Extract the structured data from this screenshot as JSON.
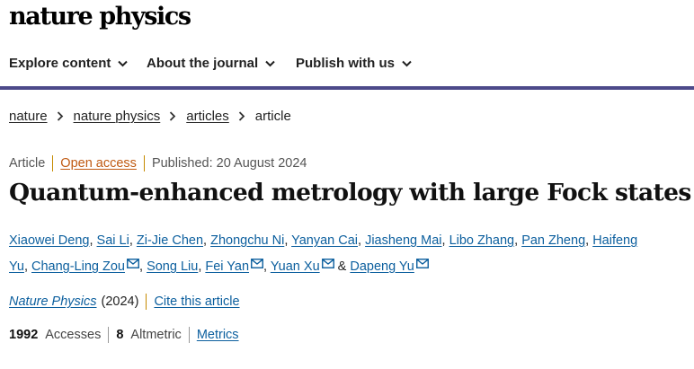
{
  "site": {
    "logo_text": "nature physics"
  },
  "nav": {
    "items": [
      {
        "label": "Explore content"
      },
      {
        "label": "About the journal"
      },
      {
        "label": "Publish with us"
      }
    ],
    "rule_color": "#4d4a8a"
  },
  "breadcrumb": {
    "items": [
      "nature",
      "nature physics",
      "articles"
    ],
    "current": "article"
  },
  "meta": {
    "type": "Article",
    "open_access": "Open access",
    "published": "Published: 20 August 2024"
  },
  "article": {
    "title": "Quantum-enhanced metrology with large Fock states"
  },
  "authors": {
    "list": [
      {
        "name": "Xiaowei Deng",
        "suffix": ", ",
        "email": false
      },
      {
        "name": "Sai Li",
        "suffix": ", ",
        "email": false
      },
      {
        "name": "Zi-Jie Chen",
        "suffix": ", ",
        "email": false
      },
      {
        "name": "Zhongchu Ni",
        "suffix": ", ",
        "email": false
      },
      {
        "name": "Yanyan Cai",
        "suffix": ", ",
        "email": false
      },
      {
        "name": "Jiasheng Mai",
        "suffix": ", ",
        "email": false
      },
      {
        "name": "Libo Zhang",
        "suffix": ", ",
        "email": false
      },
      {
        "name": "Pan Zheng",
        "suffix": ", ",
        "email": false
      },
      {
        "name": "Haifeng Yu",
        "suffix": ", ",
        "email": false
      },
      {
        "name": "Chang-Ling Zou",
        "suffix": ", ",
        "email": true
      },
      {
        "name": "Song Liu",
        "suffix": ", ",
        "email": false
      },
      {
        "name": "Fei Yan",
        "suffix": ", ",
        "email": true
      },
      {
        "name": "Yuan Xu",
        "suffix": " & ",
        "email": true
      },
      {
        "name": "Dapeng Yu",
        "suffix": "",
        "email": true
      }
    ]
  },
  "citation": {
    "journal": "Nature Physics",
    "year": "(2024)",
    "cite_label": "Cite this article"
  },
  "metrics": {
    "accesses_count": "1992",
    "accesses_label": "Accesses",
    "altmetric_count": "8",
    "altmetric_label": "Altmetric",
    "metrics_link": "Metrics"
  },
  "colors": {
    "link": "#0c5f9e",
    "open_access": "#c05a12",
    "separator": "#c58a00"
  },
  "icons": {
    "nav_chevron": "chevron-down-icon",
    "breadcrumb_separator": "chevron-right-icon",
    "email": "mail-icon"
  }
}
